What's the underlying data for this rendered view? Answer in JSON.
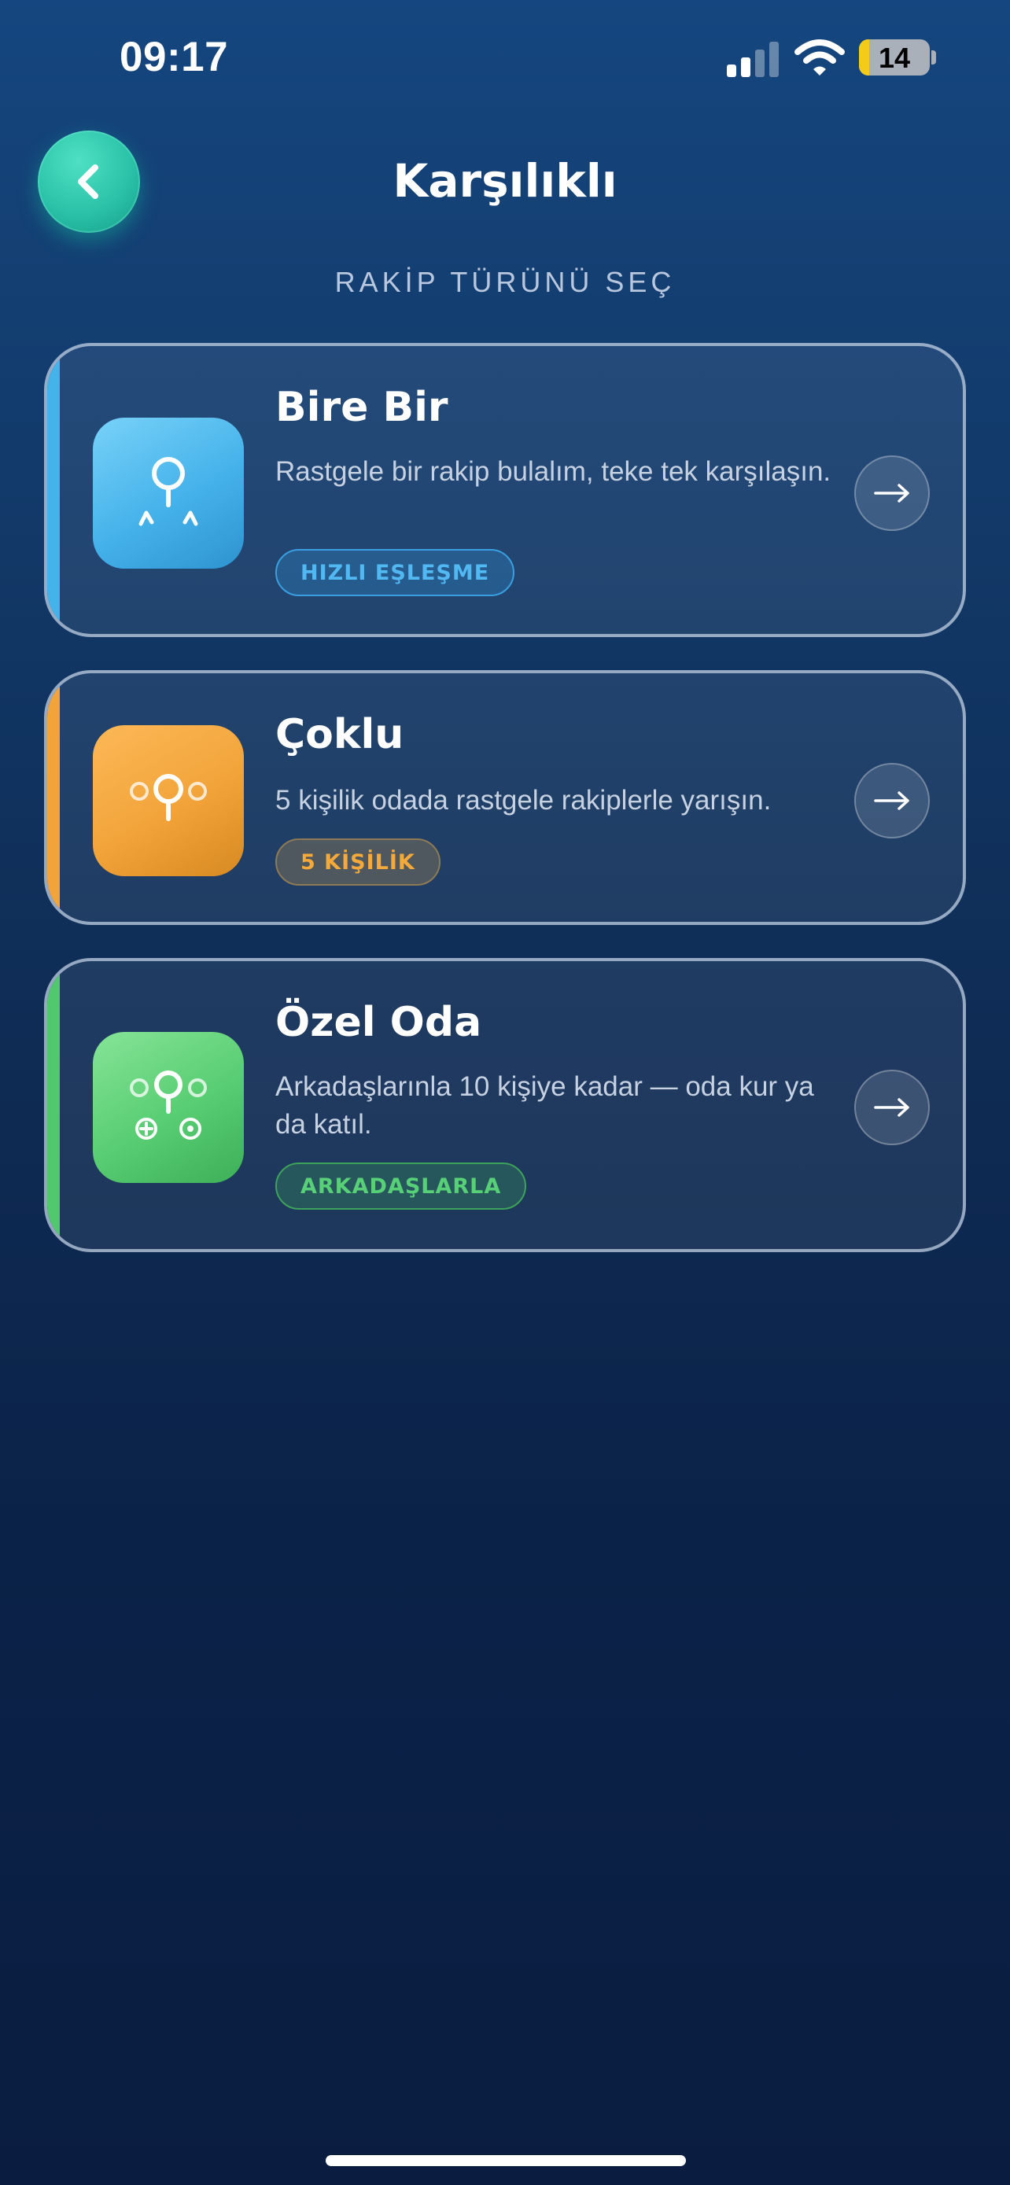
{
  "status_bar": {
    "time": "09:17",
    "battery_level": "14",
    "battery_fraction": 0.14
  },
  "header": {
    "title": "Karşılıklı",
    "back_icon": "chevron-left-icon"
  },
  "section_title": "RAKİP TÜRÜNÜ SEÇ",
  "cards": [
    {
      "title": "Bire Bir",
      "description": "Rastgele bir rakip bulalım, teke tek karşılaşın.",
      "badge": "HIZLI EŞLEŞME",
      "icon": "one-on-one-icon",
      "accent_color": "#43b3ea"
    },
    {
      "title": "Çoklu",
      "description": "5 kişilik odada rastgele rakiplerle yarışın.",
      "badge": "5 KİŞİLİK",
      "icon": "group-icon",
      "accent_color": "#f2a43a"
    },
    {
      "title": "Özel Oda",
      "description": "Arkadaşlarınla 10 kişiye kadar — oda kur ya da katıl.",
      "badge": "ARKADAŞLARLA",
      "icon": "private-room-icon",
      "accent_color": "#51c76e"
    }
  ],
  "colors": {
    "background_top": "#15467f",
    "background_bottom": "#0a1d40",
    "back_button": "#2ac2a8"
  }
}
